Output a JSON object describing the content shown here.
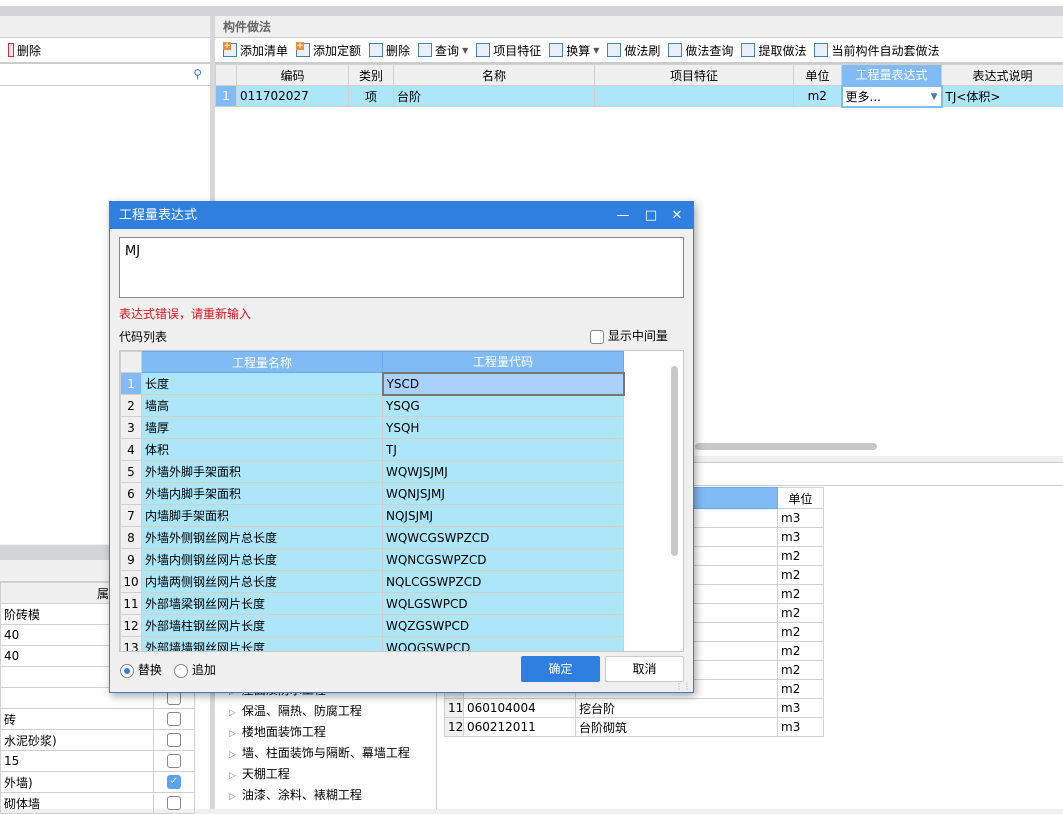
{
  "left_panel": {
    "toolbar": {
      "delete_label": "删除"
    },
    "search": {
      "placeholder": ""
    },
    "props": {
      "header_value": "属性值",
      "rows": [
        {
          "value": "阶砖模",
          "checked": null
        },
        {
          "value": "40",
          "checked": null
        },
        {
          "value": "40",
          "checked": null
        },
        {
          "value": "",
          "checked": null
        },
        {
          "value": "",
          "checked": false
        },
        {
          "value": "砖",
          "checked": false
        },
        {
          "value": "水泥砂浆)",
          "checked": false
        },
        {
          "value": "15",
          "checked": false
        },
        {
          "value": "外墙)",
          "checked": true
        },
        {
          "value": "砌体墙",
          "checked": false
        }
      ]
    }
  },
  "right_panel": {
    "title": "构件做法",
    "toolbar": [
      {
        "label": "添加清单",
        "icon": "add-list-icon"
      },
      {
        "label": "添加定额",
        "icon": "add-quota-icon"
      },
      {
        "label": "删除",
        "icon": "delete-icon"
      },
      {
        "label": "查询",
        "icon": "search-icon",
        "dropdown": true
      },
      {
        "label": "项目特征",
        "icon": "feature-icon"
      },
      {
        "label": "换算",
        "icon": "fx-icon",
        "dropdown": true
      },
      {
        "label": "做法刷",
        "icon": "brush-icon"
      },
      {
        "label": "做法查询",
        "icon": "query-icon"
      },
      {
        "label": "提取做法",
        "icon": "extract-icon"
      },
      {
        "label": "当前构件自动套做法",
        "icon": "auto-apply-icon"
      }
    ],
    "columns": [
      "编码",
      "类别",
      "名称",
      "项目特征",
      "单位",
      "工程量表达式",
      "表达式说明"
    ],
    "rows": [
      {
        "index": "1",
        "code": "011702027",
        "type": "项",
        "name": "台阶",
        "feature": "",
        "unit": "m2",
        "expression": "更多...",
        "desc": "TJ<体积>"
      }
    ]
  },
  "lower_table": {
    "unit_header": "单位",
    "rows": [
      {
        "index": "",
        "code": "",
        "name": "",
        "unit": "m3"
      },
      {
        "index": "",
        "code": "",
        "name": "",
        "unit": "m3"
      },
      {
        "index": "",
        "code": "",
        "name": "",
        "unit": "m2"
      },
      {
        "index": "",
        "code": "",
        "name": "",
        "unit": "m2"
      },
      {
        "index": "",
        "code": "",
        "name": "",
        "unit": "m2"
      },
      {
        "index": "",
        "code": "",
        "name": "",
        "unit": "m2"
      },
      {
        "index": "",
        "code": "",
        "name": "",
        "unit": "m2"
      },
      {
        "index": "",
        "code": "",
        "name": "",
        "unit": "m2"
      },
      {
        "index": "",
        "code": "",
        "name": "",
        "unit": "m2"
      },
      {
        "index": "",
        "code": "",
        "name": "",
        "unit": "m2"
      },
      {
        "index": "11",
        "code": "060104004",
        "name": "挖台阶",
        "unit": "m3"
      },
      {
        "index": "12",
        "code": "060212011",
        "name": "台阶砌筑",
        "unit": "m3"
      }
    ]
  },
  "tree": {
    "items": [
      "屋面及防水工程",
      "保温、隔热、防腐工程",
      "楼地面装饰工程",
      "墙、柱面装饰与隔断、幕墙工程",
      "天棚工程",
      "油漆、涂料、裱糊工程"
    ]
  },
  "dialog": {
    "title": "工程量表达式",
    "expression": "MJ",
    "error": "表达式错误，请重新输入",
    "code_list_label": "代码列表",
    "show_intermediate_label": "显示中间量",
    "show_intermediate": false,
    "columns": [
      "工程量名称",
      "工程量代码"
    ],
    "rows": [
      {
        "index": "1",
        "name": "长度",
        "code": "YSCD"
      },
      {
        "index": "2",
        "name": "墙高",
        "code": "YSQG"
      },
      {
        "index": "3",
        "name": "墙厚",
        "code": "YSQH"
      },
      {
        "index": "4",
        "name": "体积",
        "code": "TJ"
      },
      {
        "index": "5",
        "name": "外墙外脚手架面积",
        "code": "WQWJSJMJ"
      },
      {
        "index": "6",
        "name": "外墙内脚手架面积",
        "code": "WQNJSJMJ"
      },
      {
        "index": "7",
        "name": "内墙脚手架面积",
        "code": "NQJSJMJ"
      },
      {
        "index": "8",
        "name": "外墙外侧钢丝网片总长度",
        "code": "WQWCGSWPZCD"
      },
      {
        "index": "9",
        "name": "外墙内侧钢丝网片总长度",
        "code": "WQNCGSWPZCD"
      },
      {
        "index": "10",
        "name": "内墙两侧钢丝网片总长度",
        "code": "NQLCGSWPZCD"
      },
      {
        "index": "11",
        "name": "外部墙梁钢丝网片长度",
        "code": "WQLGSWPCD"
      },
      {
        "index": "12",
        "name": "外部墙柱钢丝网片长度",
        "code": "WQZGSWPCD"
      },
      {
        "index": "13",
        "name": "外部墙墙钢丝网片长度",
        "code": "WQQGSWPCD"
      }
    ],
    "mode_replace_label": "替换",
    "mode_append_label": "追加",
    "mode": "替换",
    "ok_label": "确定",
    "cancel_label": "取消"
  },
  "colors": {
    "accent": "#2e7fe0",
    "header_blue": "#80bbf5",
    "row_cyan": "#ade6f8",
    "error": "#e0121e"
  }
}
